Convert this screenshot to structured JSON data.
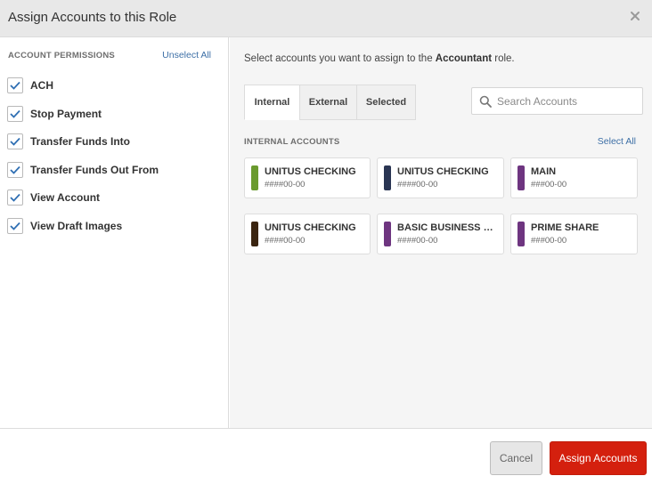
{
  "dialog": {
    "title": "Assign Accounts to this Role",
    "close_icon": "close-icon"
  },
  "permissions": {
    "title": "ACCOUNT PERMISSIONS",
    "unselect_all": "Unselect All",
    "items": [
      {
        "label": "ACH",
        "checked": true
      },
      {
        "label": "Stop Payment",
        "checked": true
      },
      {
        "label": "Transfer Funds Into",
        "checked": true
      },
      {
        "label": "Transfer Funds Out From",
        "checked": true
      },
      {
        "label": "View Account",
        "checked": true
      },
      {
        "label": "View Draft Images",
        "checked": true
      }
    ]
  },
  "main": {
    "instruction_prefix": "Select accounts you want to assign to the ",
    "role": "Accountant",
    "instruction_suffix": " role.",
    "tabs": [
      {
        "label": "Internal",
        "active": true
      },
      {
        "label": "External",
        "active": false
      },
      {
        "label": "Selected",
        "active": false
      }
    ],
    "search": {
      "placeholder": "Search Accounts",
      "value": "",
      "icon": "search-icon"
    },
    "section_title": "INTERNAL ACCOUNTS",
    "select_all": "Select All",
    "accounts": [
      {
        "name": "UNITUS CHECKING",
        "number": "####00-00",
        "color": "#6a9a2e"
      },
      {
        "name": "UNITUS CHECKING",
        "number": "####00-00",
        "color": "#2a3553"
      },
      {
        "name": "MAIN",
        "number": "###00-00",
        "color": "#6e3580"
      },
      {
        "name": "UNITUS CHECKING",
        "number": "####00-00",
        "color": "#3a2410"
      },
      {
        "name": "BASIC BUSINESS CHECKING",
        "number": "####00-00",
        "color": "#6e3580"
      },
      {
        "name": "PRIME SHARE",
        "number": "###00-00",
        "color": "#6e3580"
      }
    ]
  },
  "footer": {
    "cancel_label": "Cancel",
    "assign_label": "Assign Accounts"
  },
  "colors": {
    "accent_red": "#d4200e",
    "link_blue": "#3d6fa6",
    "check_blue": "#2f6fb3"
  }
}
